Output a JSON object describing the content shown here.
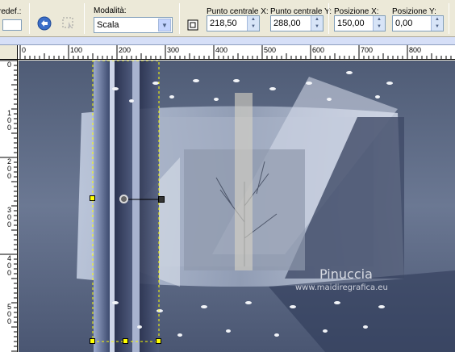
{
  "toolbar": {
    "preset_label": "redef.:",
    "mode_label": "Modalità:",
    "mode_value": "Scala",
    "center_x_label": "Punto centrale X:",
    "center_x_value": "218,50",
    "center_y_label": "Punto centrale Y:",
    "center_y_value": "288,00",
    "pos_x_label": "Posizione X:",
    "pos_x_value": "150,00",
    "pos_y_label": "Posizione Y:",
    "pos_y_value": "0,00"
  },
  "ruler": {
    "h_ticks": [
      "0",
      "100",
      "200",
      "300",
      "400",
      "500",
      "600",
      "700",
      "800"
    ],
    "v_ticks": [
      "0",
      "100",
      "200",
      "300",
      "400",
      "500"
    ]
  },
  "canvas": {
    "watermark_name": "Pinuccia",
    "watermark_url": "www.maidiregrafica.eu"
  },
  "colors": {
    "toolbar_bg": "#ece9d8",
    "canvas_bg": "#5a6780",
    "selection": "#ffff00"
  }
}
